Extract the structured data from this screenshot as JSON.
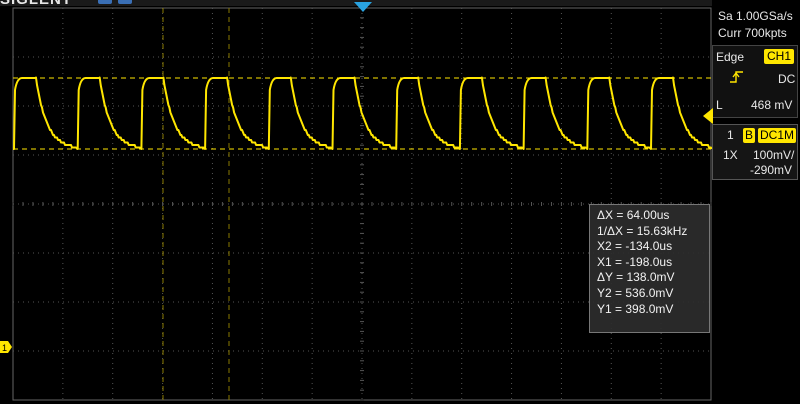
{
  "brand": "SIGLENT",
  "acquisition": {
    "sample_rate": "Sa 1.00GSa/s",
    "memory": "Curr 700kpts"
  },
  "trigger": {
    "type_label": "Edge",
    "source": "CH1",
    "coupling": "DC",
    "level_label": "L",
    "level": "468 mV"
  },
  "channel": {
    "number": "1",
    "bw_flag": "B",
    "coupling": "DC1M",
    "probe": "1X",
    "scale": "100mV/",
    "offset": "-290mV",
    "marker": "1"
  },
  "cursors": {
    "delta_x_label": "ΔX =",
    "delta_x": "64.00us",
    "inv_delta_x_label": "1/ΔX =",
    "inv_delta_x": "15.63kHz",
    "x2_label": "X2 =",
    "x2": "-134.0us",
    "x1_label": "X1 =",
    "x1": "-198.0us",
    "delta_y_label": "ΔY =",
    "delta_y": "138.0mV",
    "y2_label": "Y2 =",
    "y2": "536.0mV",
    "y1_label": "Y1 =",
    "y1": "398.0mV"
  },
  "colors": {
    "trace": "#ffe600",
    "grid": "#555555",
    "cursor": "#ffe600",
    "trigger_marker": "#29a3e0"
  },
  "waveform": {
    "periods_visible": 11
  }
}
